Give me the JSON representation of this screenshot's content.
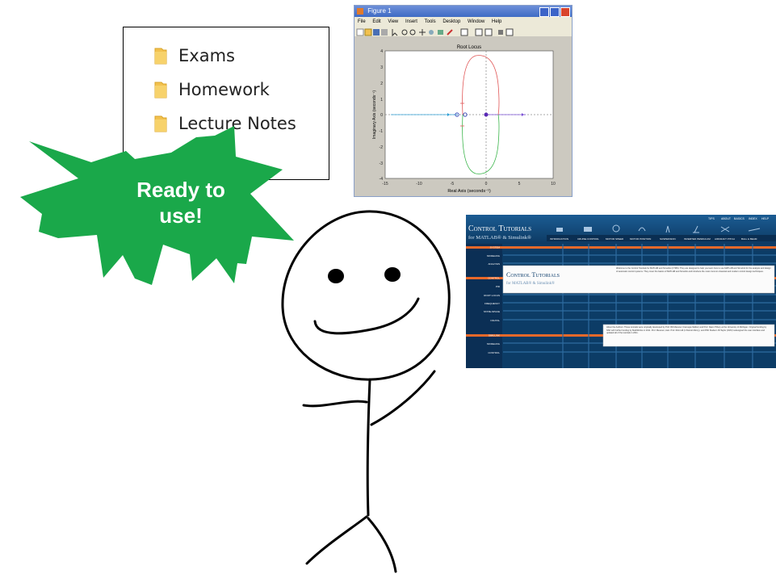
{
  "folders": {
    "items": [
      {
        "label": "Exams",
        "icon": "folder-icon"
      },
      {
        "label": "Homework",
        "icon": "folder-icon"
      },
      {
        "label": "Lecture Notes",
        "icon": "folder-icon"
      }
    ],
    "icon_color": "#f2c14e"
  },
  "figure": {
    "window_title": "Figure 1",
    "menu": [
      "File",
      "Edit",
      "View",
      "Insert",
      "Tools",
      "Desktop",
      "Window",
      "Help"
    ],
    "plot_title": "Root Locus",
    "xlabel": "Real Axis (seconds⁻¹)",
    "ylabel": "Imaginary Axis (seconds⁻¹)",
    "x_ticks": [
      "-15",
      "-10",
      "-5",
      "0",
      "5",
      "10"
    ],
    "y_ticks": [
      "4",
      "3",
      "2",
      "1",
      "0",
      "-1",
      "-2",
      "-3",
      "-4"
    ]
  },
  "tutorials": {
    "brand_line1": "Control Tutorials",
    "brand_line2": "for MATLAB® & Simulink®",
    "top_links": [
      "TIPS",
      "ABOUT",
      "BASICS",
      "INDEX",
      "HELP"
    ],
    "tabs": [
      "INTRODUCTION",
      "CRUISE CONTROL",
      "MOTOR SPEED",
      "MOTOR POSITION",
      "SUSPENSION",
      "INVERTED PENDULUM",
      "AIRCRAFT PITCH",
      "BALL & BEAM"
    ],
    "sidebar": [
      "SYSTEM",
      "MODELING",
      "ANALYSIS",
      "CONTROL",
      "PID",
      "ROOT LOCUS",
      "FREQUENCY",
      "STATE-SPACE",
      "DIGITAL",
      "SIMULINK",
      "MODELING",
      "CONTROL"
    ],
    "intro_text": "Welcome to the Control Tutorials for MATLAB and Simulink (CTMS): They are designed to help you learn how to use MATLAB and Simulink for the analysis and design of automatic control systems. They cover the basics of MATLAB and Simulink and introduce the most common classical and modern control design techniques.",
    "authors_text": "About the Authors: These tutorials were originally developed by Prof. Bill Messner (Carnegie Mellon) and Prof. Dawn Tilbury at the University of Michigan. Original funding by NSF with further funding by MathWorks in 2011. Prof. Messner, Asst. Prof. Rick Hill (U Detroit Mercy), and PhD Student JD Taylor (CMU) redesigned the user interface and updated all of the tutorials in 2011.",
    "accent_color": "#e8692a"
  },
  "callout": {
    "text_line1": "Ready to",
    "text_line2": "use!",
    "color": "#1aa84a"
  }
}
